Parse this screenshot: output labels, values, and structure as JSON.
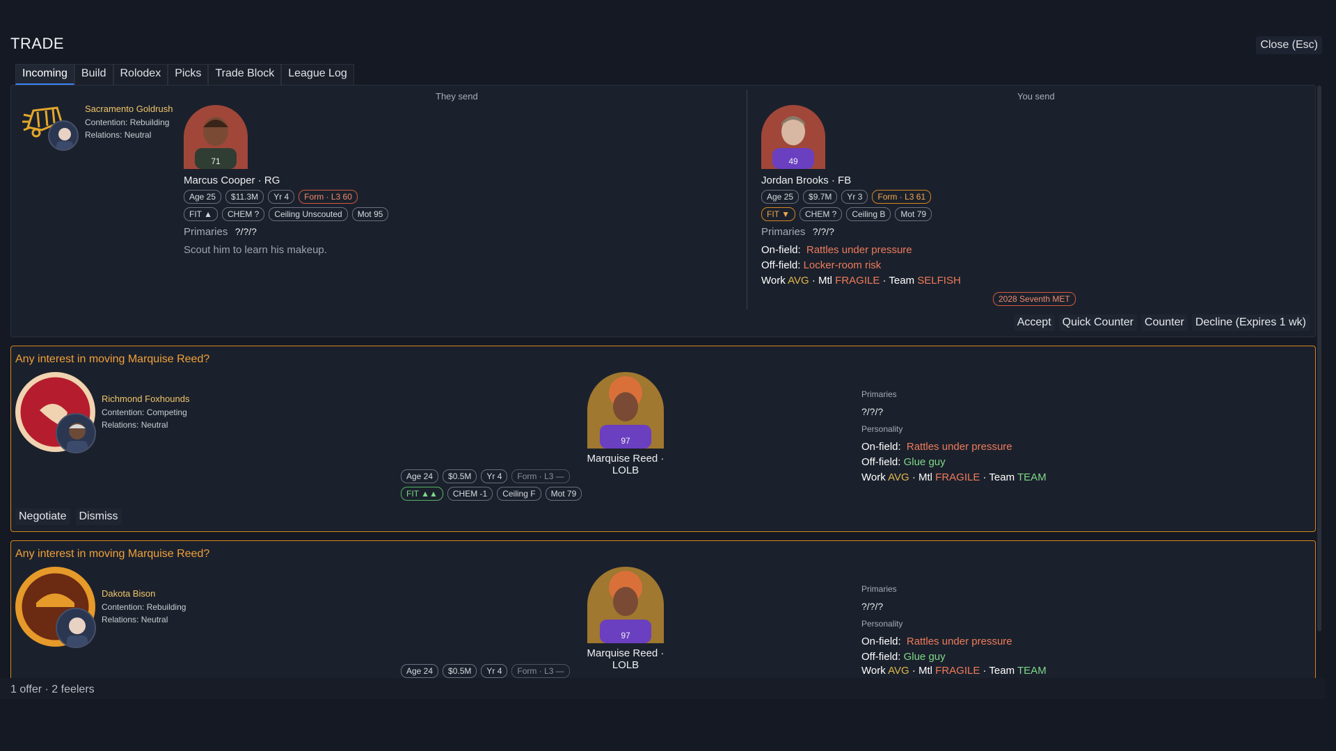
{
  "window": {
    "title": "TRADE",
    "close_label": "Close (Esc)"
  },
  "tabs": [
    {
      "label": "Incoming",
      "active": true
    },
    {
      "label": "Build"
    },
    {
      "label": "Rolodex"
    },
    {
      "label": "Picks"
    },
    {
      "label": "Trade Block"
    },
    {
      "label": "League Log"
    }
  ],
  "offer": {
    "team": {
      "name": "Sacramento Goldrush",
      "contention": "Contention: Rebuilding",
      "relations": "Relations: Neutral"
    },
    "they_send_label": "They send",
    "you_send_label": "You send",
    "incoming_player": {
      "number": "71",
      "name_line": "Marcus Cooper  ·  RG",
      "chips_row1": [
        "Age 25",
        "$11.3M",
        "Yr 4",
        "Form · L3 60"
      ],
      "chips_row2": [
        "FIT ▲",
        "CHEM ?",
        "Ceiling Unscouted",
        "Mot 95"
      ],
      "primaries_label": "Primaries",
      "primaries_value": "?/?/?",
      "note": "Scout him to learn his makeup."
    },
    "outgoing_player": {
      "number": "49",
      "name_line": "Jordan Brooks  ·  FB",
      "chips_row1": [
        "Age 25",
        "$9.7M",
        "Yr 3",
        "Form · L3 61"
      ],
      "chips_row2": [
        "FIT ▼",
        "CHEM ?",
        "Ceiling B",
        "Mot 79"
      ],
      "primaries_label": "Primaries",
      "primaries_value": "?/?/?",
      "onfield_label": "On-field:",
      "onfield_value": "Rattles under pressure",
      "offfield_label": "Off-field:",
      "offfield_value": "Locker-room risk",
      "work_label": "Work",
      "work_value": "AVG",
      "mtl_label": "· Mtl",
      "mtl_value": "FRAGILE",
      "team_label": "· Team",
      "team_value": "SELFISH"
    },
    "pick": "2028 Seventh MET",
    "actions": [
      "Accept",
      "Quick Counter",
      "Counter",
      "Decline (Expires 1 wk)"
    ]
  },
  "feelers": [
    {
      "title": "Any interest in moving Marquise Reed?",
      "team": {
        "name": "Richmond Foxhounds",
        "contention": "Contention: Competing",
        "relations": "Relations: Neutral"
      },
      "player": {
        "number": "97",
        "name_line": "Marquise Reed · LOLB",
        "chips_row1": [
          "Age 24",
          "$0.5M",
          "Yr 4",
          "Form · L3 —"
        ],
        "chips_row2": [
          "FIT ▲▲",
          "CHEM -1",
          "Ceiling F",
          "Mot 79"
        ]
      },
      "primaries_label": "Primaries",
      "primaries_value": "?/?/?",
      "personality_label": "Personality",
      "onfield_label": "On-field:",
      "onfield_value": "Rattles under pressure",
      "offfield_label": "Off-field:",
      "offfield_value": "Glue guy",
      "work_label": "Work",
      "work_value": "AVG",
      "mtl_label": "· Mtl",
      "mtl_value": "FRAGILE",
      "team_label": "· Team",
      "team_value": "TEAM",
      "actions": [
        "Negotiate",
        "Dismiss"
      ]
    },
    {
      "title": "Any interest in moving Marquise Reed?",
      "team": {
        "name": "Dakota Bison",
        "contention": "Contention: Rebuilding",
        "relations": "Relations: Neutral"
      },
      "player": {
        "number": "97",
        "name_line": "Marquise Reed · LOLB",
        "chips_row1": [
          "Age 24",
          "$0.5M",
          "Yr 4",
          "Form · L3 —"
        ]
      },
      "primaries_label": "Primaries",
      "primaries_value": "?/?/?",
      "personality_label": "Personality",
      "onfield_label": "On-field:",
      "onfield_value": "Rattles under pressure",
      "offfield_label": "Off-field:",
      "offfield_value": "Glue guy",
      "work_label": "Work",
      "work_value": "AVG",
      "mtl_label": "· Mtl",
      "mtl_value": "FRAGILE",
      "team_label": "· Team",
      "team_value": "TEAM"
    }
  ],
  "footer": {
    "summary": "1 offer · 2 feelers"
  },
  "colors": {
    "accent_orange": "#d9851f",
    "gold": "#f0c66a",
    "negative": "#ef7b5c",
    "positive": "#7fd98a",
    "purple_jersey": "#6a3fc0"
  }
}
